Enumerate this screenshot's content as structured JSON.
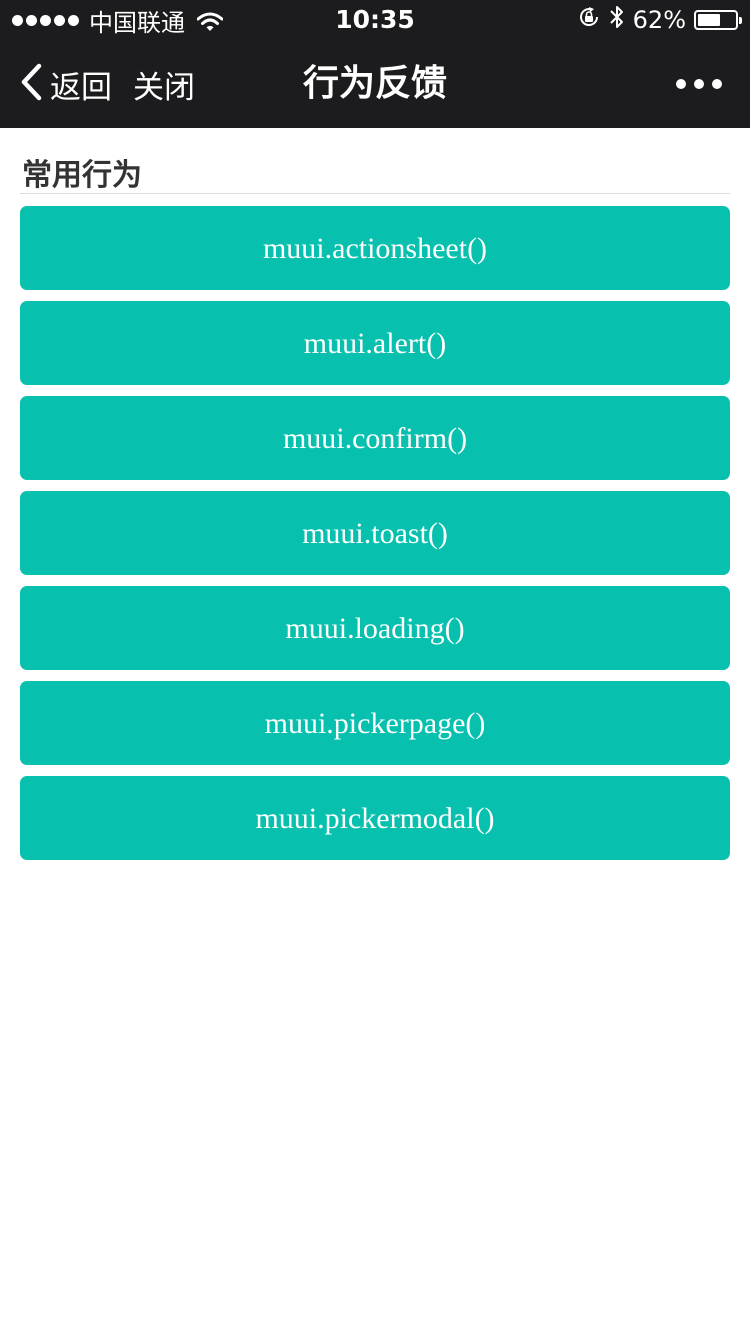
{
  "status_bar": {
    "carrier": "中国联通",
    "time": "10:35",
    "battery_percent": "62%",
    "battery_level": 0.62,
    "icons": [
      "signal-dots-icon",
      "wifi-icon",
      "orientation-lock-icon",
      "bluetooth-icon",
      "battery-icon"
    ]
  },
  "nav": {
    "back_label": "返回",
    "close_label": "关闭",
    "title": "行为反馈",
    "more_icon": "more-dots-icon",
    "back_icon": "chevron-left-icon"
  },
  "section": {
    "title": "常用行为"
  },
  "buttons": [
    {
      "label": "muui.actionsheet()"
    },
    {
      "label": "muui.alert()"
    },
    {
      "label": "muui.confirm()"
    },
    {
      "label": "muui.toast()"
    },
    {
      "label": "muui.loading()"
    },
    {
      "label": "muui.pickerpage()"
    },
    {
      "label": "muui.pickermodal()"
    }
  ],
  "colors": {
    "bar_background": "#1c1c1e",
    "button_background": "#07c1ae",
    "button_text": "#ffffff",
    "section_title": "#333333"
  }
}
